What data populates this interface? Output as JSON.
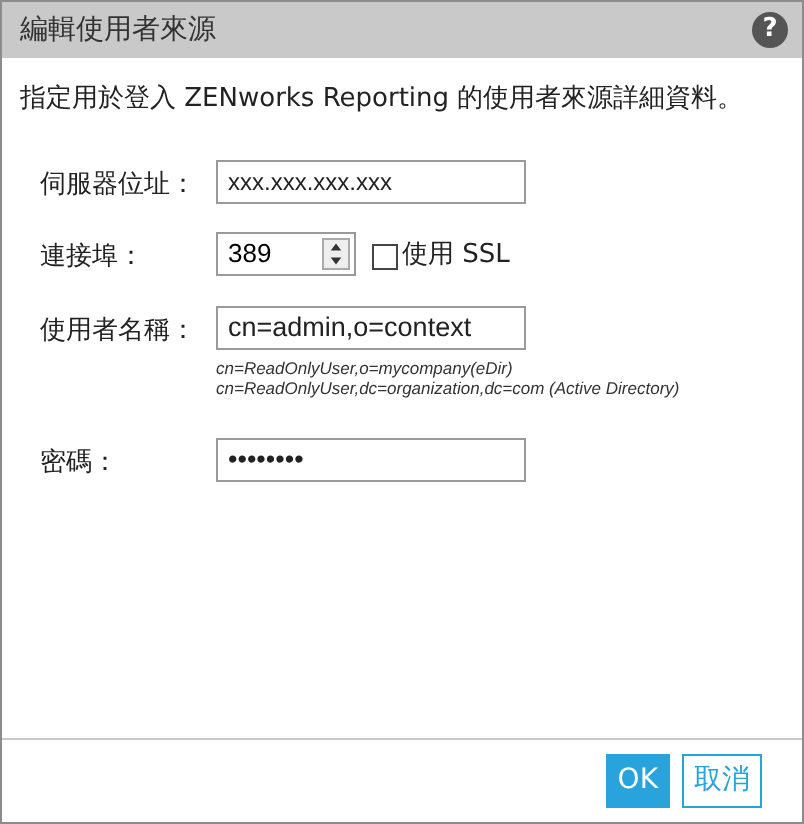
{
  "window": {
    "title": "編輯使用者來源",
    "help": "?"
  },
  "description": "指定用於登入 ZENworks Reporting 的使用者來源詳細資料。",
  "fields": [
    {
      "kind": "text",
      "label": "伺服器位址：",
      "value": "xxx.xxx.xxx.xxx"
    },
    {
      "kind": "spinner",
      "label": "連接埠：",
      "value": "389",
      "checkbox": {
        "label": "使用 SSL",
        "checked": false
      }
    },
    {
      "kind": "text",
      "label": "使用者名稱：",
      "value": "cn=admin,o=context",
      "hints": [
        "cn=ReadOnlyUser,o=mycompany(eDir)",
        "cn=ReadOnlyUser,dc=organization,dc=com (Active Directory)"
      ]
    },
    {
      "kind": "text",
      "label": "密碼：",
      "value": "••••••••"
    }
  ],
  "buttons": [
    {
      "label": "OK",
      "primary": true
    },
    {
      "label": "取消",
      "primary": false
    }
  ]
}
